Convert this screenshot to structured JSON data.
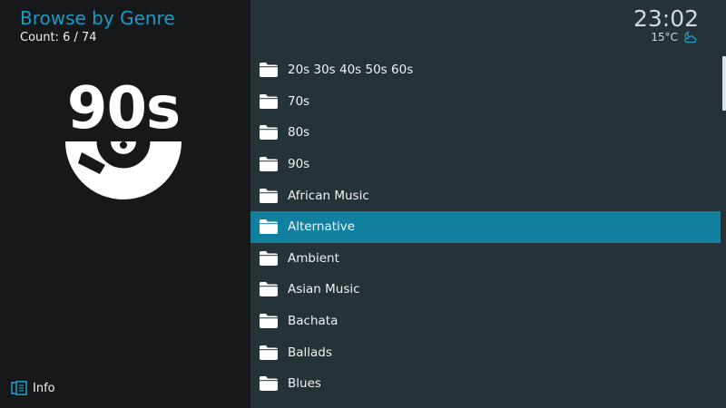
{
  "header": {
    "title": "Browse by Genre",
    "count": "Count: 6 / 74"
  },
  "artwork": {
    "label": "90s",
    "icon": "vinyl-record-icon",
    "color": "#ffffff"
  },
  "footer": {
    "info_label": "Info",
    "info_icon": "info-panel-icon"
  },
  "status": {
    "time": "23:02",
    "temperature": "15°C",
    "weather_icon": "partly-cloudy-night-icon"
  },
  "genres": [
    "20s 30s 40s 50s 60s",
    "70s",
    "80s",
    "90s",
    "African Music",
    "Alternative",
    "Ambient",
    "Asian Music",
    "Bachata",
    "Ballads",
    "Blues"
  ],
  "selected_genre": "Alternative",
  "list_position": {
    "selected_index": 6,
    "total": 74
  },
  "colors": {
    "accent": "#1a9bc6",
    "selection": "#12809f",
    "left_background": "#161819",
    "right_background": "#253238"
  }
}
